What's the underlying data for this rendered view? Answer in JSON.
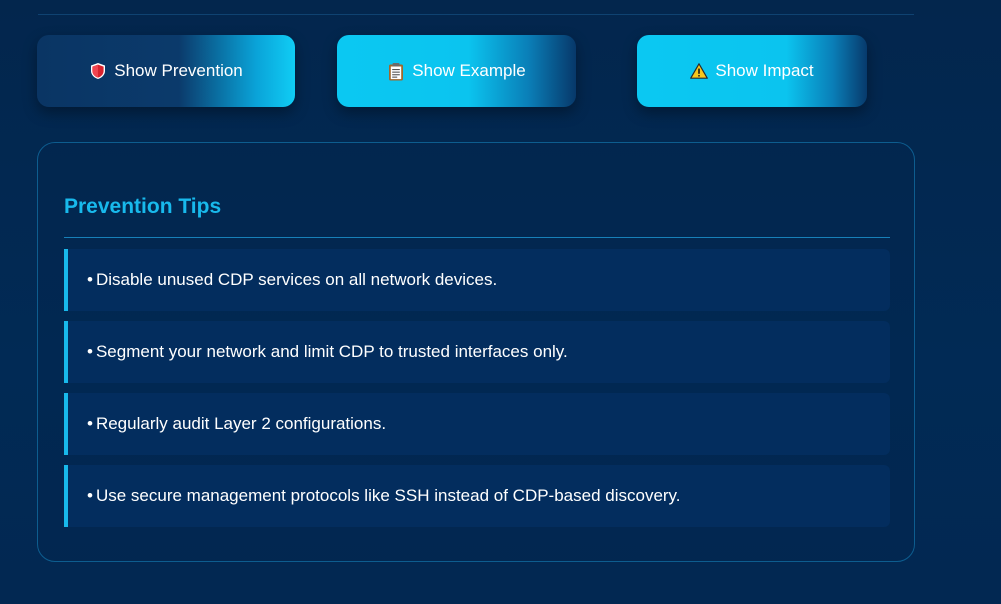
{
  "buttons": {
    "prevention": {
      "label": "Show Prevention",
      "icon": "shield-icon"
    },
    "example": {
      "label": "Show Example",
      "icon": "clipboard-icon"
    },
    "impact": {
      "label": "Show Impact",
      "icon": "warning-icon"
    }
  },
  "panel": {
    "title": "Prevention Tips",
    "bullet": "•",
    "tips": [
      "Disable unused CDP services on all network devices.",
      "Segment your network and limit CDP to trusted interfaces only.",
      "Regularly audit Layer 2 configurations.",
      "Use secure management protocols like SSH instead of CDP-based discovery."
    ]
  },
  "colors": {
    "background": "#022a55",
    "accent": "#18b9ec",
    "button_cyan": "#0bc8f2",
    "tip_background": "#032d5e",
    "panel_border": "#0d5d8f"
  }
}
